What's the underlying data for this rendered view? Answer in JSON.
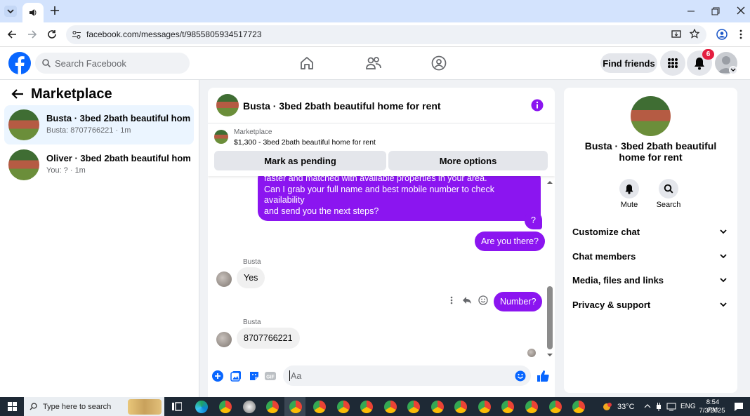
{
  "browser": {
    "url": "facebook.com/messages/t/9855805934517723"
  },
  "fb": {
    "search_placeholder": "Search Facebook",
    "find_friends": "Find friends",
    "notif_count": "6"
  },
  "left": {
    "title": "Marketplace",
    "conversations": [
      {
        "title": "Busta · 3bed 2bath beautiful home...",
        "sub": "Busta: 8707766221 · 1m"
      },
      {
        "title": "Oliver · 3bed 2bath beautiful hom...",
        "sub": "You: ? · 1m"
      }
    ]
  },
  "chat": {
    "title": "Busta · 3bed 2bath beautiful home for rent",
    "listing_label": "Marketplace",
    "listing_detail": "$1,300 - 3bed 2bath beautiful home for rent",
    "mark_pending": "Mark as pending",
    "more_options": "More options",
    "messages": {
      "long_line1": "faster and matched with available properties in your area.",
      "long_line2": "Can I grab your full name and best mobile number to check availability",
      "long_line3": "and send you the next steps?",
      "q": "?",
      "are_you_there": "Are you there?",
      "sender1": "Busta",
      "yes": "Yes",
      "number": "Number?",
      "sender2": "Busta",
      "phone": "8707766221"
    },
    "composer_placeholder": "Aa"
  },
  "right": {
    "title": "Busta · 3bed 2bath beautiful home for rent",
    "mute": "Mute",
    "search": "Search",
    "sections": [
      "Customize chat",
      "Chat members",
      "Media, files and links",
      "Privacy & support"
    ]
  },
  "taskbar": {
    "search": "Type here to search",
    "temp": "33°C",
    "lang": "ENG",
    "time": "8:54 PM",
    "date": "7/3/2025"
  },
  "colors": {
    "fb_blue": "#0866ff",
    "messenger_purple": "#8b15f0"
  }
}
